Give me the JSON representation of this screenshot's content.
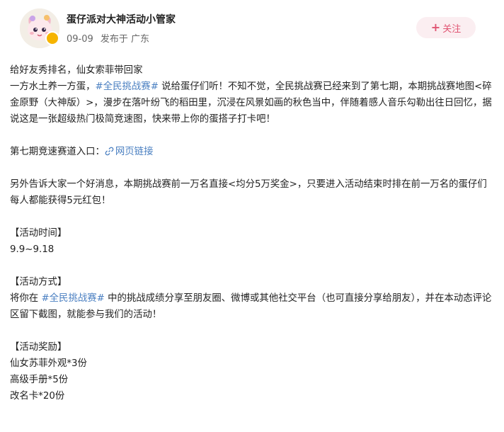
{
  "author": {
    "name": "蛋仔派对大神活动小管家",
    "avatar_icon": "cartoon-avatar-icon",
    "badge_icon": "verified-badge-icon",
    "badge_color": "#f6b400"
  },
  "meta": {
    "date": "09-09",
    "location": "发布于 广东"
  },
  "follow": {
    "label": "关注",
    "bg_color": "#fbeef1",
    "text_color": "#e05573"
  },
  "post": {
    "line1": "给好友秀排名，仙女索菲带回家",
    "para1_prefix": "一方水土养一方蛋，",
    "para1_tag": "#全民挑战赛#",
    "para1_suffix": " 说给蛋仔们听！不知不觉，全民挑战赛已经来到了第七期，本期挑战赛地图<碎金原野（大神版）>，漫步在落叶纷飞的稻田里，沉浸在风景如画的秋色当中，伴随着感人音乐勾勒出往日回忆，据说这是一张超级热门极简竞速图，快来带上你的蛋搭子打卡吧！",
    "entry_label": "第七期竞速赛道入口：",
    "entry_link": "网页链接",
    "news": "另外告诉大家一个好消息，本期挑战赛前一万名直接<均分5万奖金>，只要进入活动结束时排在前一万名的蛋仔们每人都能获得5元红包！",
    "time_title": "【活动时间】",
    "time_value": "9.9~9.18",
    "method_title": "【活动方式】",
    "method_prefix": "将你在 ",
    "method_tag": "#全民挑战赛#",
    "method_suffix": " 中的挑战成绩分享至朋友圈、微博或其他社交平台（也可直接分享给朋友），并在本动态评论区留下截图，就能参与我们的活动！",
    "reward_title": "【活动奖励】",
    "rewards": [
      "仙女苏菲外观*3份",
      "高级手册*5份",
      "改名卡*20份"
    ],
    "tag_color": "#4a7fc1"
  }
}
